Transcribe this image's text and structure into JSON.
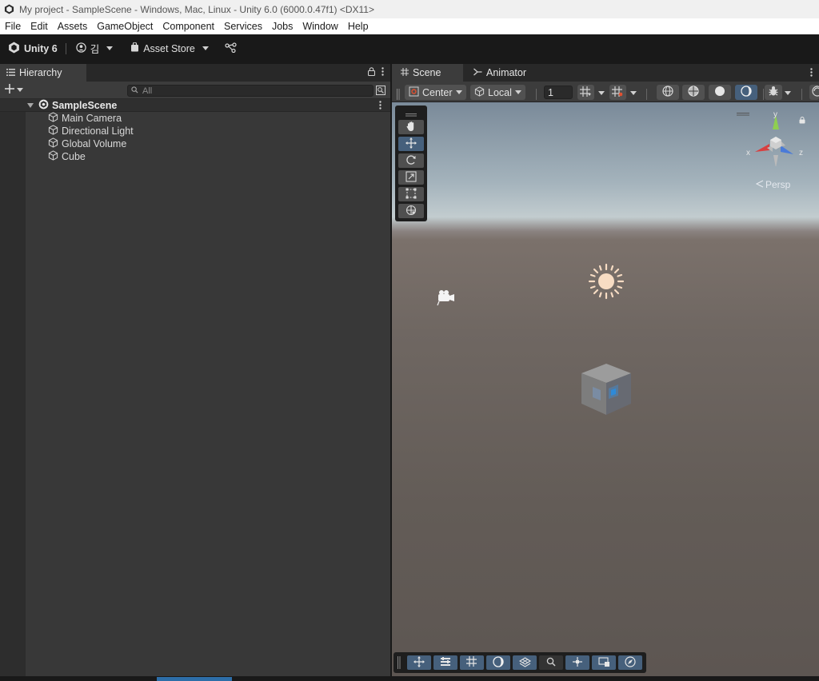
{
  "window": {
    "title": "My project - SampleScene - Windows, Mac, Linux - Unity 6.0 (6000.0.47f1) <DX11>"
  },
  "menu": [
    "File",
    "Edit",
    "Assets",
    "GameObject",
    "Component",
    "Services",
    "Jobs",
    "Window",
    "Help"
  ],
  "toolbar": {
    "unity_label": "Unity 6",
    "account_label": "김",
    "asset_store_label": "Asset Store"
  },
  "hierarchy": {
    "tab_label": "Hierarchy",
    "search_placeholder": "All",
    "scene_name": "SampleScene",
    "items": [
      "Main Camera",
      "Directional Light",
      "Global Volume",
      "Cube"
    ]
  },
  "scene_view": {
    "tabs": [
      {
        "label": "Scene"
      },
      {
        "label": "Animator"
      }
    ],
    "pivot_mode": "Center",
    "pivot_rotation": "Local",
    "grid_size": "1",
    "gizmo": {
      "y_label": "y",
      "x_label": "x",
      "z_label": "z",
      "projection": "Persp"
    }
  },
  "colors": {
    "accent": "#46607c",
    "panel": "#383838",
    "status_accent": "#2d6ea8"
  }
}
